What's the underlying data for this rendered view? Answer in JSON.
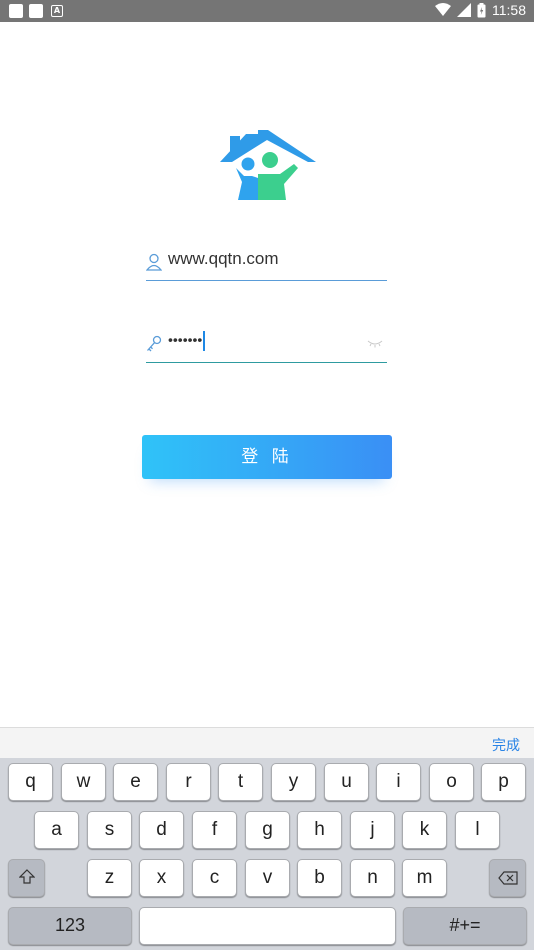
{
  "status_bar": {
    "time": "11:58",
    "left_icons": [
      "notification-square-icon",
      "notification-square-icon",
      "a-letter-icon"
    ],
    "right_icons": [
      "wifi-icon",
      "signal-icon",
      "battery-icon"
    ]
  },
  "login": {
    "username_value": "www.qqtn.com",
    "password_value": "•••••••",
    "login_button_label": "登 陆"
  },
  "keyboard": {
    "done_label": "完成",
    "row1": [
      "q",
      "w",
      "e",
      "r",
      "t",
      "y",
      "u",
      "i",
      "o",
      "p"
    ],
    "row2": [
      "a",
      "s",
      "d",
      "f",
      "g",
      "h",
      "j",
      "k",
      "l"
    ],
    "row3": [
      "z",
      "x",
      "c",
      "v",
      "b",
      "n",
      "m"
    ],
    "numbers_label": "123",
    "symbols_label": "#+="
  },
  "colors": {
    "button_gradient_start": "#2fc3f8",
    "button_gradient_end": "#3a8ff5",
    "logo_blue": "#2f9be8",
    "logo_green": "#3ccf8e",
    "accent": "#2a84e6"
  }
}
